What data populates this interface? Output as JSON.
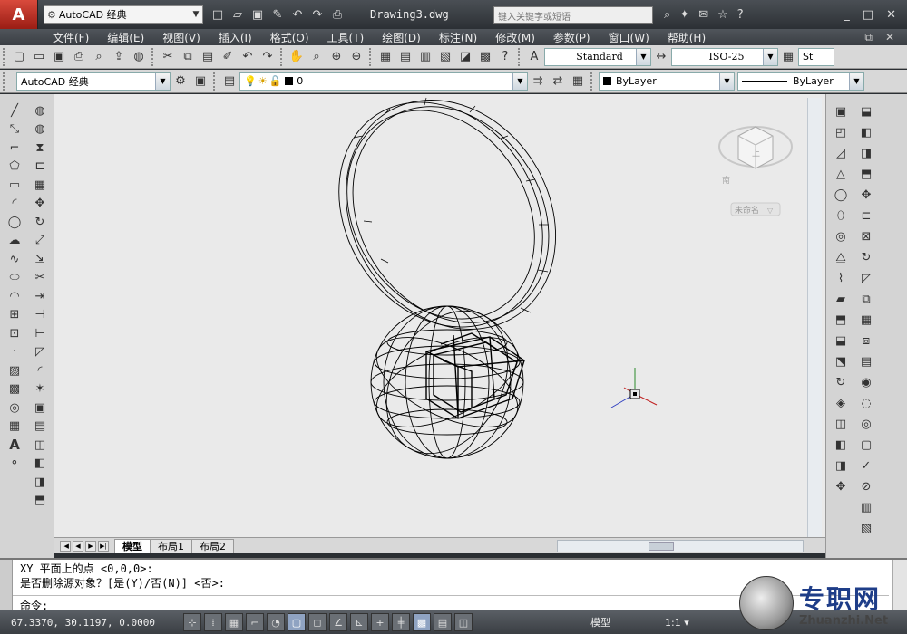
{
  "titlebar": {
    "workspace": "AutoCAD 经典",
    "document": "Drawing3.dwg",
    "search_placeholder": "键入关键字或短语"
  },
  "menubar": {
    "items": [
      "文件(F)",
      "编辑(E)",
      "视图(V)",
      "插入(I)",
      "格式(O)",
      "工具(T)",
      "绘图(D)",
      "标注(N)",
      "修改(M)",
      "参数(P)",
      "窗口(W)",
      "帮助(H)"
    ]
  },
  "toolbar": {
    "text_style": "Standard",
    "dim_style": "ISO-25",
    "table_style": "St"
  },
  "layers": {
    "workspace": "AutoCAD 经典",
    "current_layer": "0",
    "color": "ByLayer",
    "linetype": "ByLayer"
  },
  "viewcube": {
    "top": "上",
    "view_name": "未命名",
    "compass": "南"
  },
  "tabs": {
    "model": "模型",
    "layout1": "布局1",
    "layout2": "布局2"
  },
  "command": {
    "line1": "XY 平面上的点 <0,0,0>:",
    "line2": "是否删除源对象？[是(Y)/否(N)] <否>:",
    "prompt": "命令:"
  },
  "status": {
    "coords": "67.3370, 30.1197, 0.0000",
    "model": "模型",
    "scale": "1:1"
  },
  "watermark": {
    "cn": "专职网",
    "url": "Zhuanzhi.Net"
  },
  "colors": {
    "accent": "#2b5ea8",
    "canvas": "#eaeaea"
  }
}
